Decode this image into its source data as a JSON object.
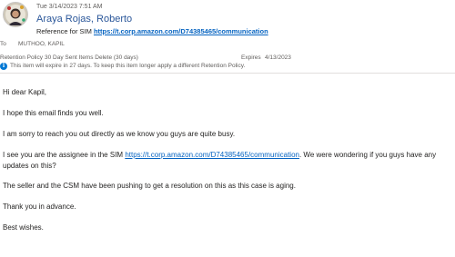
{
  "header": {
    "date": "Tue 3/14/2023 7:51 AM",
    "sender": "Araya Rojas, Roberto",
    "subject_prefix": "Reference for SIM ",
    "subject_link": "https://t.corp.amazon.com/D74385465/communication",
    "to_label": "To",
    "to_value": "MUTHOO, KAPIL",
    "retention_label": "Retention Policy",
    "retention_value": "30 Day Sent Items Delete (30 days)",
    "expires_label": "Expires",
    "expires_value": "4/13/2023",
    "info_text": "This item will expire in 27 days. To keep this item longer apply a different Retention Policy."
  },
  "icons": {
    "avatar": "avatar-photo",
    "to": "person-icon",
    "info": "info-icon"
  },
  "body": {
    "greeting": "Hi dear Kapil,",
    "p1": "I hope this email finds you well.",
    "p2": "I am sorry to reach you out directly as we know you guys are quite busy.",
    "p3_before": "I see you are the assignee in the SIM ",
    "p3_link": "https://t.corp.amazon.com/D74385465/communication",
    "p3_after": ". We were wondering if you guys have any",
    "p3_line2": "updates on this?",
    "p4": "The seller and the CSM have been pushing to get a resolution on this as this case is aging.",
    "p5": "Thank you in advance.",
    "p6": "Best wishes."
  },
  "colors": {
    "sender": "#2b579a",
    "link": "#0563c1",
    "info": "#0078d4"
  }
}
